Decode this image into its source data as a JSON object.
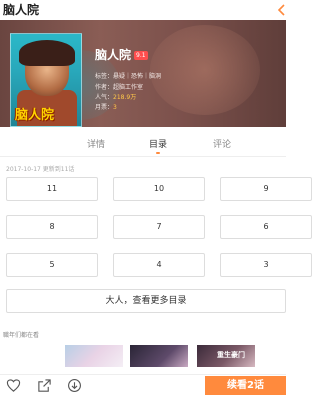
{
  "header": {
    "title": "脑人院"
  },
  "manga": {
    "title": "脑人院",
    "rating": "9.1",
    "cover_text": "脑人院",
    "tags_label": "标签：",
    "tags": "悬疑｜恐怖｜脑洞",
    "author_label": "作者：",
    "author": "超脑工作室",
    "popularity_label": "人气：",
    "popularity": "218.9万",
    "monthly_label": "月票：",
    "monthly": "3"
  },
  "tabs": [
    {
      "label": "详情"
    },
    {
      "label": "目录"
    },
    {
      "label": "评论"
    }
  ],
  "catalog": {
    "update_note": "2017-10-17 更新到11话",
    "chapters": [
      "11",
      "10",
      "9",
      "8",
      "7",
      "6",
      "5",
      "4",
      "3"
    ],
    "more_label": "大人，查看更多目录"
  },
  "recommend": {
    "label": "職年们都在看",
    "items": [
      {
        "text": ""
      },
      {
        "text": ""
      },
      {
        "text": "重生豪门"
      }
    ]
  },
  "bottom": {
    "continue_label": "续看2话"
  },
  "colors": {
    "accent": "#ff8a3d",
    "rating_bg": "#ff4e4e",
    "highlight": "#ffc94a"
  }
}
